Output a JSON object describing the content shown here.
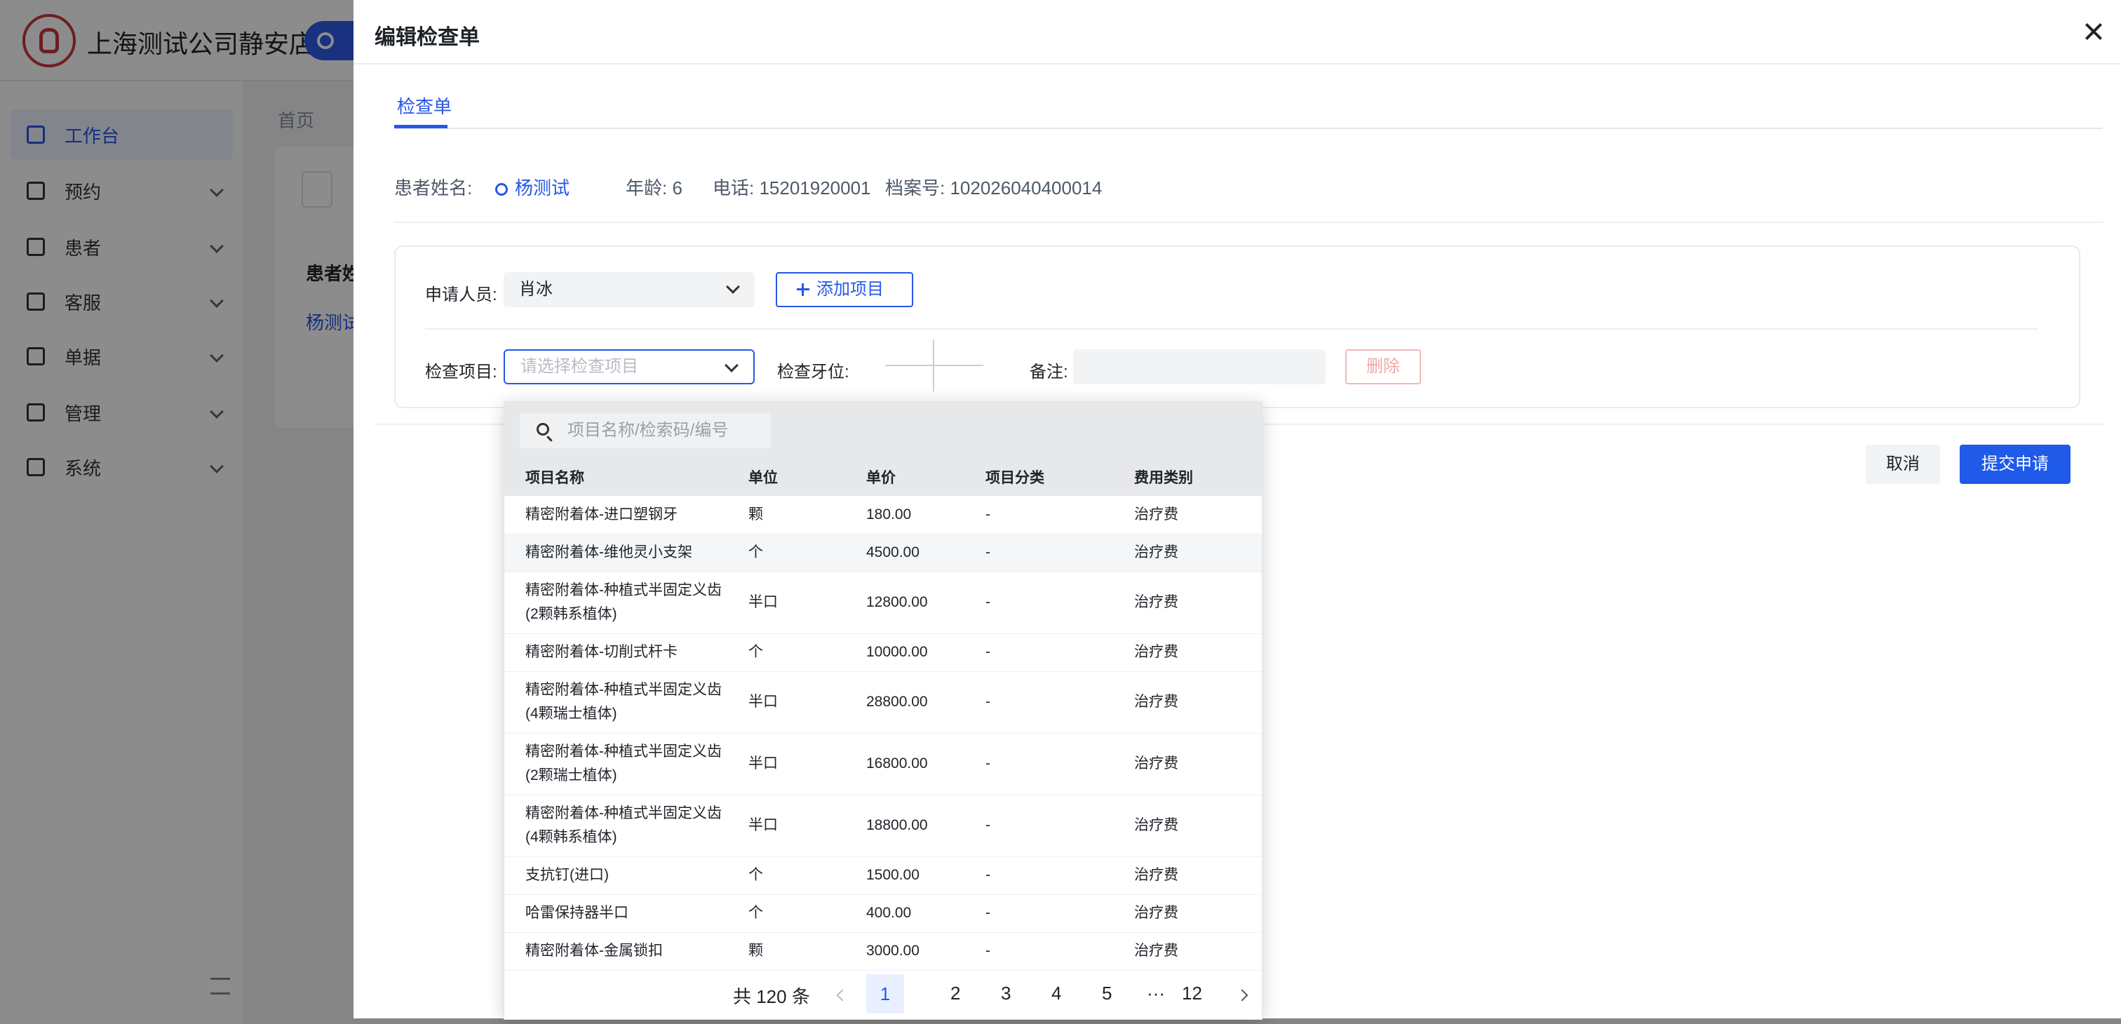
{
  "app": {
    "brand": "上海测试公司静安店",
    "sidebar": [
      {
        "label": "工作台"
      },
      {
        "label": "预约"
      },
      {
        "label": "患者"
      },
      {
        "label": "客服"
      },
      {
        "label": "单据"
      },
      {
        "label": "管理"
      },
      {
        "label": "系统"
      }
    ],
    "breadcrumb_home": "首页",
    "bg_patient_label": "患者姓",
    "bg_patient_link": "杨测试"
  },
  "drawer": {
    "title": "编辑检查单",
    "tab": "检查单",
    "patient": {
      "name_label": "患者姓名:",
      "name": "杨测试",
      "age": "年龄: 6",
      "phone": "电话: 15201920001",
      "file_no": "档案号: 102026040400014"
    },
    "form": {
      "applicant_label": "申请人员:",
      "applicant_value": "肖冰",
      "add_item": "添加项目",
      "item_label": "检查项目:",
      "item_placeholder": "请选择检查项目",
      "tooth_label": "检查牙位:",
      "note_label": "备注:",
      "delete": "删除"
    },
    "cancel": "取消",
    "submit": "提交申请"
  },
  "dropdown": {
    "search_placeholder": "项目名称/检索码/编号",
    "columns": [
      "项目名称",
      "单位",
      "单价",
      "项目分类",
      "费用类别"
    ],
    "rows": [
      {
        "name": "精密附着体-进口塑钢牙",
        "unit": "颗",
        "price": "180.00",
        "category": "-",
        "fee": "治疗费"
      },
      {
        "name": "精密附着体-维他灵小支架",
        "unit": "个",
        "price": "4500.00",
        "category": "-",
        "fee": "治疗费"
      },
      {
        "name": "精密附着体-种植式半固定义齿(2颗韩系植体)",
        "unit": "半口",
        "price": "12800.00",
        "category": "-",
        "fee": "治疗费"
      },
      {
        "name": "精密附着体-切削式杆卡",
        "unit": "个",
        "price": "10000.00",
        "category": "-",
        "fee": "治疗费"
      },
      {
        "name": "精密附着体-种植式半固定义齿(4颗瑞士植体)",
        "unit": "半口",
        "price": "28800.00",
        "category": "-",
        "fee": "治疗费"
      },
      {
        "name": "精密附着体-种植式半固定义齿(2颗瑞士植体)",
        "unit": "半口",
        "price": "16800.00",
        "category": "-",
        "fee": "治疗费"
      },
      {
        "name": "精密附着体-种植式半固定义齿(4颗韩系植体)",
        "unit": "半口",
        "price": "18800.00",
        "category": "-",
        "fee": "治疗费"
      },
      {
        "name": "支抗钉(进口)",
        "unit": "个",
        "price": "1500.00",
        "category": "-",
        "fee": "治疗费"
      },
      {
        "name": "哈雷保持器半口",
        "unit": "个",
        "price": "400.00",
        "category": "-",
        "fee": "治疗费"
      },
      {
        "name": "精密附着体-金属锁扣",
        "unit": "颗",
        "price": "3000.00",
        "category": "-",
        "fee": "治疗费"
      }
    ],
    "pager": {
      "total": "共 120 条",
      "pages": [
        "1",
        "2",
        "3",
        "4",
        "5",
        "···",
        "12"
      ]
    }
  }
}
